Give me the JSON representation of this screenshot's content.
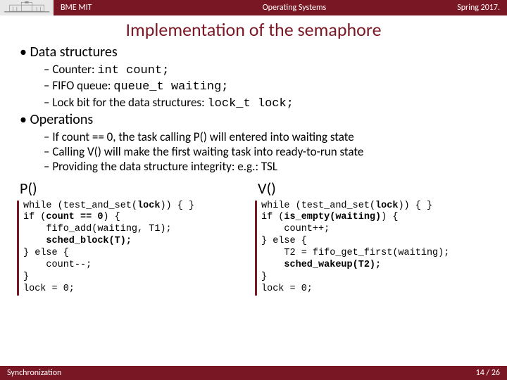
{
  "header": {
    "left": "BME MIT",
    "mid": "Operating Systems",
    "right": "Spring 2017."
  },
  "title": "Implementation of the semaphore",
  "bullets": {
    "b1a": "Data structures",
    "b2a_pre": "Counter: ",
    "b2a_code": "int count;",
    "b2b_pre": "FIFO queue: ",
    "b2b_code": "queue_t waiting;",
    "b2c_pre": "Lock bit for the data structures: ",
    "b2c_code": "lock_t lock;",
    "b1b": "Operations",
    "b2d": "If count == 0, the task calling P() will entered into waiting state",
    "b2e": "Calling V() will make the first waiting task into ready-to-run state",
    "b2f": "Providing the data structure integrity: e.g.: TSL"
  },
  "p": {
    "title": "P()",
    "l1a": "while (test_and_set(",
    "l1b": "lock",
    "l1c": ")) { }",
    "l2a": "if (",
    "l2b": "count == 0",
    "l2c": ") {",
    "l3": "    fifo_add(waiting, T1);",
    "l4a": "    ",
    "l4b": "sched_block(T);",
    "l5": "} else {",
    "l6": "    count--;",
    "l7": "}",
    "l8": "lock = 0;"
  },
  "v": {
    "title": "V()",
    "l1a": "while (test_and_set(",
    "l1b": "lock",
    "l1c": ")) { }",
    "l2a": "if (",
    "l2b": "is_empty(waiting)",
    "l2c": ") {",
    "l3": "    count++;",
    "l4": "} else {",
    "l5": "    T2 = fifo_get_first(waiting);",
    "l6a": "    ",
    "l6b": "sched_wakeup(T2);",
    "l7": "}",
    "l8": "lock = 0;"
  },
  "footer": {
    "left": "Synchronization",
    "right": "14 / 26"
  }
}
